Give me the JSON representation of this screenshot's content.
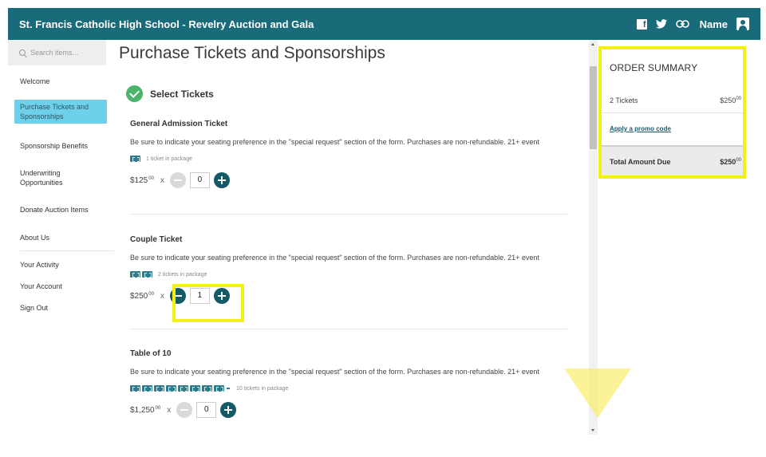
{
  "header": {
    "title": "St. Francis Catholic High School - Revelry Auction and Gala",
    "user_name": "Name"
  },
  "sidebar": {
    "search_placeholder": "Search items...",
    "items": [
      {
        "label": "Welcome"
      },
      {
        "label": "Purchase Tickets and Sponsorships"
      },
      {
        "label": "Sponsorship Benefits"
      },
      {
        "label": "Underwriting Opportunities"
      },
      {
        "label": "Donate Auction Items"
      },
      {
        "label": "About Us"
      }
    ],
    "account_items": [
      {
        "label": "Your Activity"
      },
      {
        "label": "Your Account"
      },
      {
        "label": "Sign Out"
      }
    ]
  },
  "main": {
    "page_title": "Purchase Tickets and Sponsorships",
    "step_label": "Select Tickets",
    "tickets": [
      {
        "name": "General Admission Ticket",
        "description": "Be sure to indicate your seating preference in the \"special request\" section of the form. Purchases are non-refundable. 21+ event",
        "package_text": "1 ticket in package",
        "price": "$125",
        "cents": "00",
        "times": "x",
        "quantity": "0"
      },
      {
        "name": "Couple Ticket",
        "description": "Be sure to indicate your seating preference in the \"special request\" section of the form. Purchases are non-refundable. 21+ event",
        "package_text": "2 tickets in package",
        "price": "$250",
        "cents": "00",
        "times": "x",
        "quantity": "1"
      },
      {
        "name": "Table of 10",
        "description": "Be sure to indicate your seating preference in the \"special request\" section of the form. Purchases are non-refundable. 21+ event",
        "package_text": "10 tickets in package",
        "price": "$1,250",
        "cents": "00",
        "times": "x",
        "quantity": "0"
      }
    ]
  },
  "order_summary": {
    "title": "ORDER SUMMARY",
    "tickets_label": "2 Tickets",
    "tickets_amount": "$250",
    "tickets_cents": "00",
    "promo_label": "Apply a promo code",
    "total_label": "Total Amount Due",
    "total_amount": "$250",
    "total_cents": "00"
  },
  "colors": {
    "header_bg": "#1a6b7a",
    "active_nav": "#6ed0ea",
    "stepper_active": "#135a66",
    "check_green": "#4cb36d",
    "highlight": "#f5ef18"
  },
  "icons": [
    "facebook-icon",
    "twitter-icon",
    "link-icon",
    "user-icon",
    "search-icon",
    "check-circle-icon",
    "ticket-icon",
    "minus-icon",
    "plus-icon",
    "scroll-up-arrow",
    "scroll-down-arrow",
    "pointer-triangle"
  ]
}
